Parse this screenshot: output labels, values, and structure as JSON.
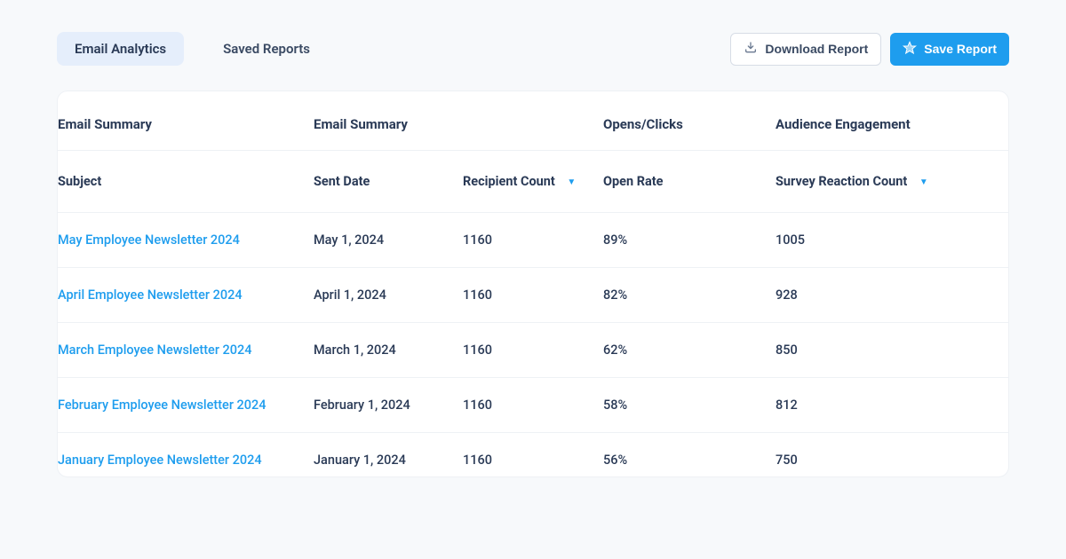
{
  "tabs": {
    "email_analytics": "Email Analytics",
    "saved_reports": "Saved Reports"
  },
  "actions": {
    "download_label": "Download Report",
    "save_label": "Save Report"
  },
  "group_headers": {
    "summary1": "Email Summary",
    "summary2": "Email Summary",
    "opens_clicks": "Opens/Clicks",
    "engagement": "Audience Engagement"
  },
  "column_headers": {
    "subject": "Subject",
    "sent_date": "Sent Date",
    "recipient_count": "Recipient Count",
    "open_rate": "Open Rate",
    "survey_reaction": "Survey Reaction Count"
  },
  "rows": [
    {
      "subject": "May Employee Newsletter 2024",
      "sent_date": "May 1, 2024",
      "recipient_count": "1160",
      "open_rate": "89%",
      "survey_reaction": "1005"
    },
    {
      "subject": "April Employee Newsletter 2024",
      "sent_date": "April 1, 2024",
      "recipient_count": "1160",
      "open_rate": "82%",
      "survey_reaction": "928"
    },
    {
      "subject": "March Employee Newsletter 2024",
      "sent_date": "March 1, 2024",
      "recipient_count": "1160",
      "open_rate": "62%",
      "survey_reaction": "850"
    },
    {
      "subject": "February Employee Newsletter 2024",
      "sent_date": "February 1, 2024",
      "recipient_count": "1160",
      "open_rate": "58%",
      "survey_reaction": "812"
    },
    {
      "subject": "January Employee Newsletter 2024",
      "sent_date": "January 1, 2024",
      "recipient_count": "1160",
      "open_rate": "56%",
      "survey_reaction": "750"
    }
  ]
}
